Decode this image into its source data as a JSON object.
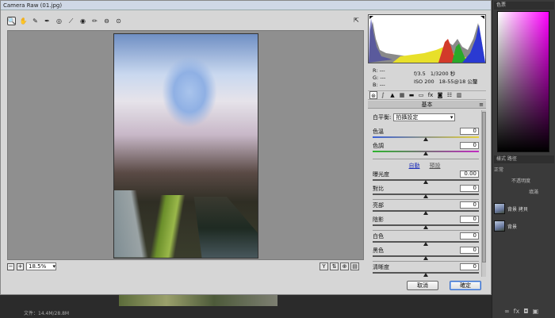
{
  "window": {
    "title": "Camera Raw (01.jpg)"
  },
  "toolbar": {
    "tools": [
      {
        "name": "zoom-tool-icon",
        "glyph": "🔍"
      },
      {
        "name": "hand-tool-icon",
        "glyph": "✋"
      },
      {
        "name": "white-balance-tool-icon",
        "glyph": "✎"
      },
      {
        "name": "color-sampler-tool-icon",
        "glyph": "✒"
      },
      {
        "name": "targeted-adjustment-tool-icon",
        "glyph": "◎"
      },
      {
        "name": "straighten-tool-icon",
        "glyph": "⟋"
      },
      {
        "name": "red-eye-tool-icon",
        "glyph": "◉"
      },
      {
        "name": "brush-tool-icon",
        "glyph": "✏"
      },
      {
        "name": "rotate-tool-icon",
        "glyph": "⊖"
      },
      {
        "name": "preferences-tool-icon",
        "glyph": "⊙"
      }
    ],
    "fullscreen_glyph": "⇱"
  },
  "preview": {
    "zoom_value": "18.5%",
    "zoom_out": "−",
    "zoom_in": "+"
  },
  "view_icons": {
    "y": "Y",
    "compare": "⇅",
    "cycle": "⊕",
    "grid": "▤"
  },
  "camera_info": {
    "r_label": "R:",
    "r_value": "---",
    "g_label": "G:",
    "g_value": "---",
    "b_label": "B:",
    "b_value": "---",
    "aperture": "f/3.5",
    "shutter": "1/3200 秒",
    "iso": "ISO 200",
    "lens": "18-55@18 公釐"
  },
  "panel": {
    "title": "基本",
    "menu_glyph": "≡",
    "white_balance_label": "白平衡:",
    "white_balance_value": "拍攝設定",
    "auto_label": "自動",
    "default_label": "預設",
    "sliders": [
      {
        "label": "色溫",
        "value": "0",
        "level": 0.5
      },
      {
        "label": "色調",
        "value": "0",
        "level": 0.5
      },
      {
        "label": "曝光度",
        "value": "0.00",
        "level": 0.5
      },
      {
        "label": "對比",
        "value": "0",
        "level": 0.5
      },
      {
        "label": "亮部",
        "value": "0",
        "level": 0.5
      },
      {
        "label": "陰影",
        "value": "0",
        "level": 0.5
      },
      {
        "label": "白色",
        "value": "0",
        "level": 0.5
      },
      {
        "label": "黑色",
        "value": "0",
        "level": 0.5
      },
      {
        "label": "清晰度",
        "value": "0",
        "level": 0.5
      }
    ]
  },
  "buttons": {
    "cancel": "取消",
    "ok": "確定"
  },
  "photoshop": {
    "color_tab": "色票",
    "tabs2": "樣式  路徑",
    "blend_mode": "正常",
    "opacity_label": "不透明度",
    "fill_label": "填滿",
    "layers": [
      {
        "name": "背景 拷貝"
      },
      {
        "name": "背景"
      }
    ],
    "status": "文件：14.4M/28.8M"
  },
  "accent_colors": {
    "primary_button": "#3a6ec8",
    "link": "#2233bb"
  }
}
